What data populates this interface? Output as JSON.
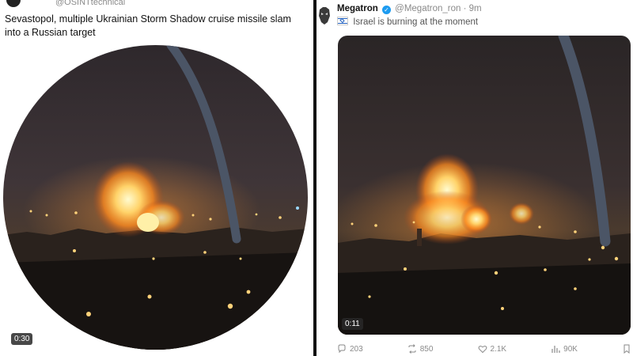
{
  "left_post": {
    "handle": "@OSINTtechnical",
    "caption": "Sevastopol, multiple Ukrainian Storm Shadow cruise missile slam into a Russian target",
    "video_duration": "0:30"
  },
  "right_post": {
    "display_name": "Megatron",
    "handle_time": "@Megatron_ron · 9m",
    "text": "Israel is burning at the moment",
    "video_duration": "0:11",
    "actions": {
      "replies": "203",
      "reposts": "850",
      "likes": "2.1K",
      "views": "90K"
    }
  },
  "colors": {
    "night_sky": "#3a3236",
    "explosion_core": "#fff6b0",
    "explosion_glow": "#ff8a1e",
    "verified": "#1d9bf0"
  },
  "icons": [
    "verified-badge-icon",
    "israel-flag-icon",
    "reply-icon",
    "repost-icon",
    "like-icon",
    "views-icon",
    "bookmark-icon"
  ]
}
